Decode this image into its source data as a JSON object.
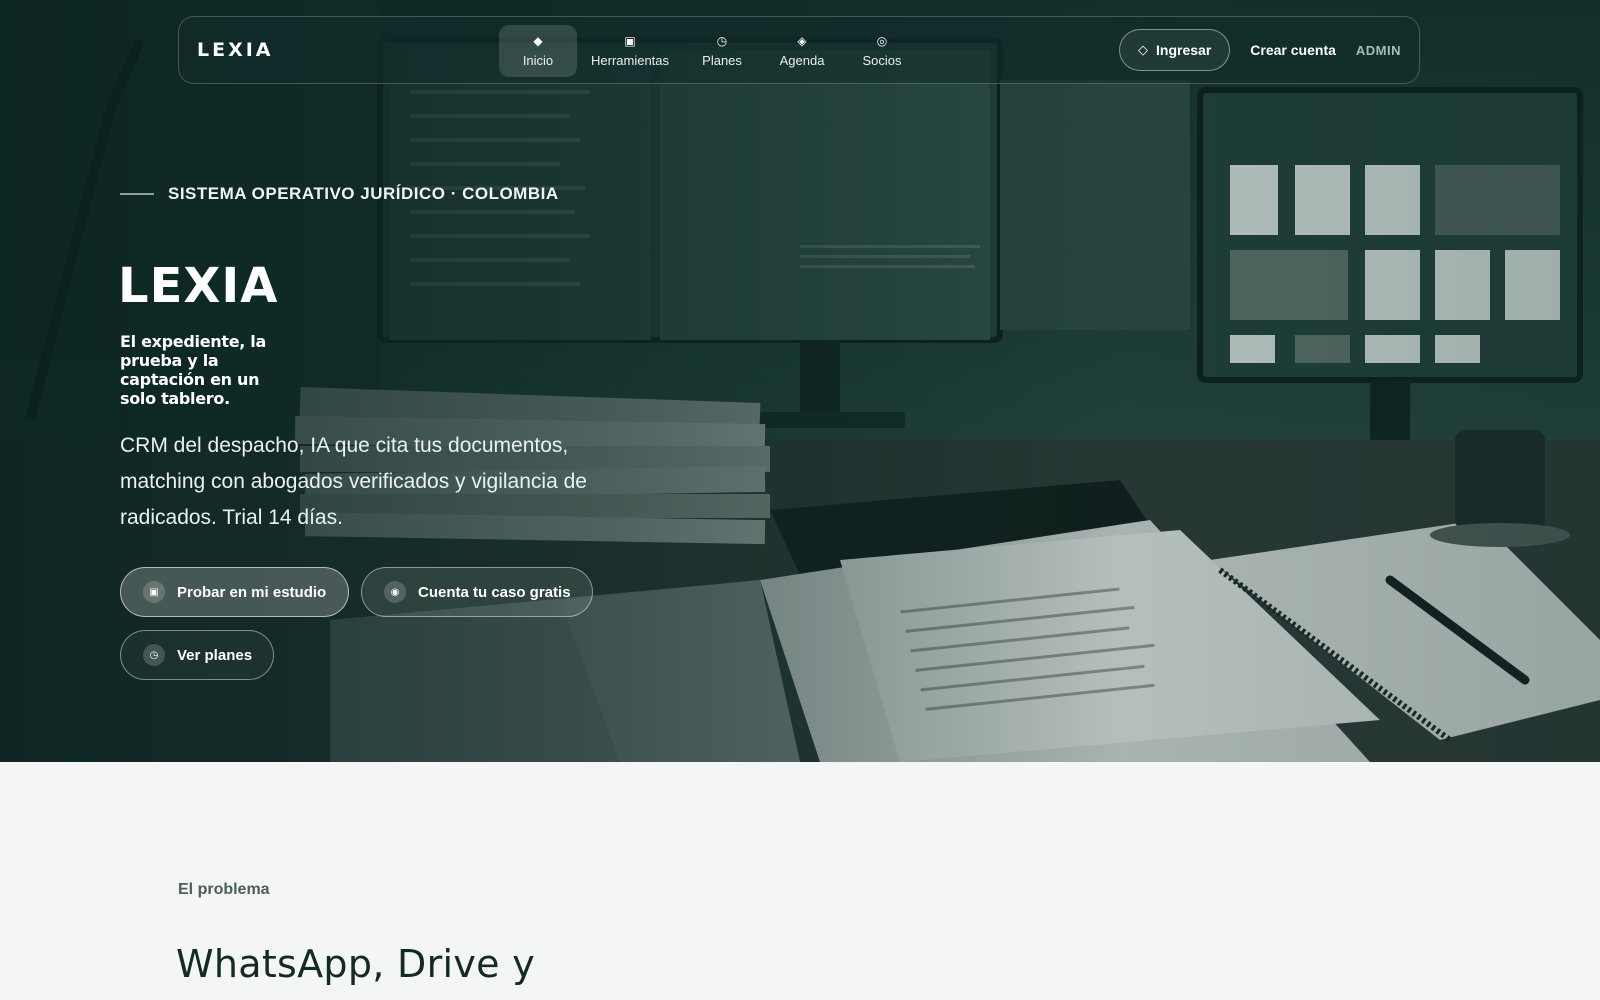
{
  "nav": {
    "logo": "LEXIA",
    "items": [
      {
        "label": "Inicio",
        "icon": "diamond-icon",
        "glyph": "◆",
        "active": true
      },
      {
        "label": "Herramientas",
        "icon": "square-icon",
        "glyph": "▣",
        "active": false
      },
      {
        "label": "Planes",
        "icon": "clock-icon",
        "glyph": "◷",
        "active": false
      },
      {
        "label": "Agenda",
        "icon": "diamond-outline-icon",
        "glyph": "◈",
        "active": false
      },
      {
        "label": "Socios",
        "icon": "target-icon",
        "glyph": "◎",
        "active": false
      }
    ],
    "login_label": "Ingresar",
    "login_icon": "◇",
    "signup_label": "Crear cuenta",
    "admin_label": "ADMIN"
  },
  "hero": {
    "eyebrow": "SISTEMA OPERATIVO JURÍDICO · COLOMBIA",
    "title": "LEXIA",
    "tagline": "El expediente, la prueba y la captación en un solo tablero.",
    "description": "CRM del despacho, IA que cita tus documentos, matching con abogados verificados y vigilancia de radicados. Trial 14 días.",
    "cta_primary": "Probar en mi estudio",
    "cta_secondary": "Cuenta tu caso gratis",
    "cta_tertiary": "Ver planes",
    "cta_primary_glyph": "▣",
    "cta_secondary_glyph": "◉",
    "cta_tertiary_glyph": "◷"
  },
  "problem": {
    "eyebrow": "El problema",
    "title": "WhatsApp, Drive y"
  },
  "colors": {
    "hero_bg": "#1d3d38",
    "accent": "#ffffff",
    "page_bg": "#f3f6f5",
    "heading_dark": "#142a27"
  }
}
